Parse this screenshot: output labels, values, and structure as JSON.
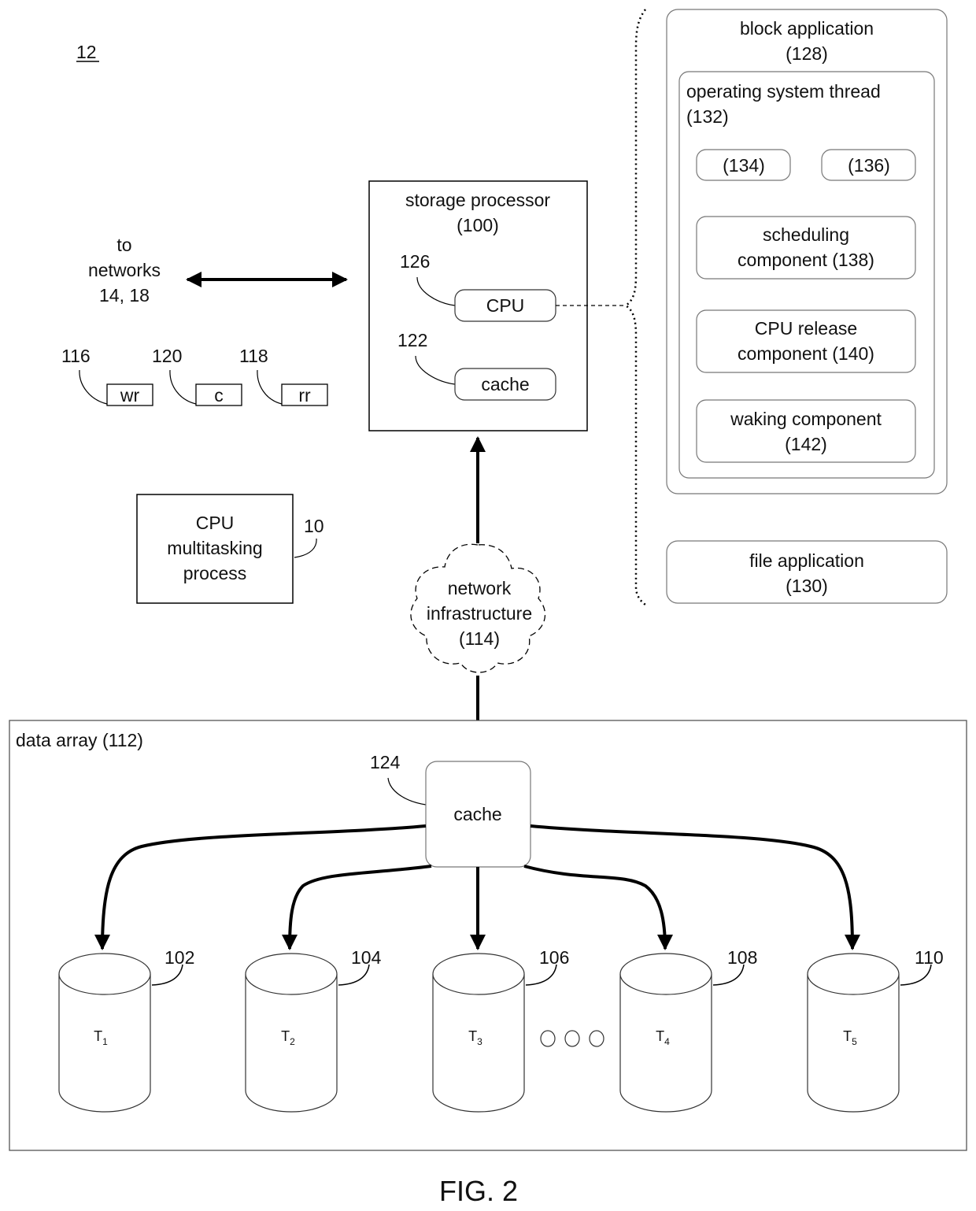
{
  "figure": {
    "label": "FIG. 2",
    "ref_number": "12"
  },
  "networks_label": [
    "to",
    "networks",
    "14, 18"
  ],
  "legend_boxes": [
    {
      "ref": "116",
      "label": "wr"
    },
    {
      "ref": "120",
      "label": "c"
    },
    {
      "ref": "118",
      "label": "rr"
    }
  ],
  "storage_processor": {
    "title": "storage processor",
    "ref": "(100)",
    "cpu": {
      "ref": "126",
      "label": "CPU"
    },
    "cache": {
      "ref": "122",
      "label": "cache"
    }
  },
  "cpu_multitasking": {
    "lines": [
      "CPU",
      "multitasking",
      "process"
    ],
    "ref": "10"
  },
  "network_infrastructure": {
    "lines": [
      "network",
      "infrastructure",
      "(114)"
    ]
  },
  "block_application": {
    "title": "block application",
    "ref": "(128)",
    "os_thread": {
      "title": "operating system thread",
      "ref": "(132)",
      "small_boxes": [
        "(134)",
        "(136)"
      ],
      "components": [
        {
          "line1": "scheduling",
          "line2": "component (138)"
        },
        {
          "line1": "CPU release",
          "line2": "component (140)"
        },
        {
          "line1": "waking component",
          "line2": "(142)"
        }
      ]
    }
  },
  "file_application": {
    "title": "file application",
    "ref": "(130)"
  },
  "data_array": {
    "title": "data array (112)",
    "cache": {
      "ref": "124",
      "label": "cache"
    },
    "targets": [
      {
        "name": "T",
        "sub": "1",
        "ref": "102"
      },
      {
        "name": "T",
        "sub": "2",
        "ref": "104"
      },
      {
        "name": "T",
        "sub": "3",
        "ref": "106"
      },
      {
        "name": "T",
        "sub": "4",
        "ref": "108"
      },
      {
        "name": "T",
        "sub": "5",
        "ref": "110"
      }
    ],
    "ellipsis": "○○○"
  }
}
